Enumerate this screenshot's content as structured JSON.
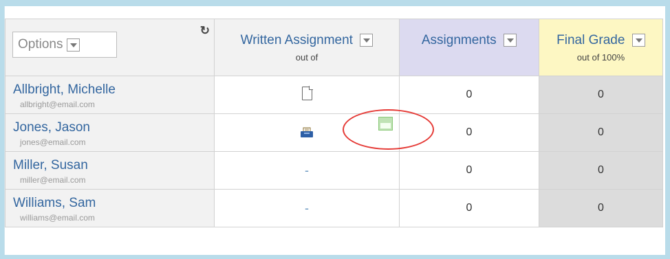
{
  "header": {
    "options": {
      "label": "Options",
      "dropdown_icon": "chevron-down-icon"
    },
    "refresh_icon": "refresh-icon",
    "columns": [
      {
        "title": "Written Assignment",
        "subtitle": "out of",
        "dropdown_icon": "chevron-down-icon",
        "bg": "#f2f2f2"
      },
      {
        "title": "Assignments",
        "subtitle": "",
        "dropdown_icon": "chevron-down-icon",
        "bg": "#dcdaf0"
      },
      {
        "title": "Final Grade",
        "subtitle": "out of 100%",
        "dropdown_icon": "chevron-down-icon",
        "bg": "#fdf7c3"
      }
    ]
  },
  "students": [
    {
      "name": "Allbright, Michelle",
      "email": "allbright@email.com",
      "written_assignment": {
        "icon": "document-icon",
        "text": ""
      },
      "assignments": "0",
      "final_grade": "0"
    },
    {
      "name": "Jones, Jason",
      "email": "jones@email.com",
      "written_assignment": {
        "icon": "inbox-icon",
        "text": "",
        "side_icon": "panel-icon"
      },
      "assignments": "0",
      "final_grade": "0"
    },
    {
      "name": "Miller, Susan",
      "email": "miller@email.com",
      "written_assignment": {
        "icon": "",
        "text": "-"
      },
      "assignments": "0",
      "final_grade": "0"
    },
    {
      "name": "Williams, Sam",
      "email": "williams@email.com",
      "written_assignment": {
        "icon": "",
        "text": "-"
      },
      "assignments": "0",
      "final_grade": "0"
    }
  ],
  "colors": {
    "link_blue": "#33669f",
    "assignments_header": "#dcdaf0",
    "final_grade_header": "#fdf7c3",
    "final_grade_cells": "#dcdcdc",
    "highlight": "#e53935",
    "page_bg": "#b9dcea"
  }
}
